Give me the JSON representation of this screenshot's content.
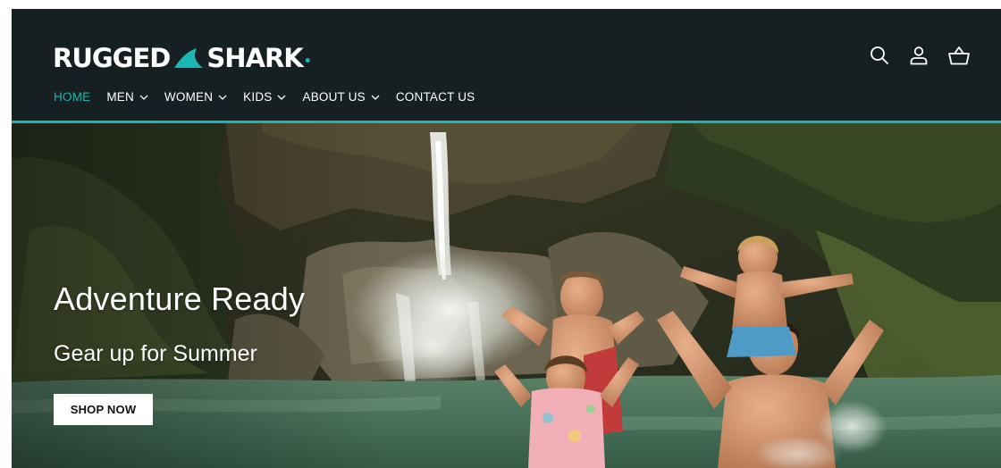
{
  "brand": {
    "name_left": "RUGGED",
    "name_right": "SHARK",
    "accent_color": "#19b6b3"
  },
  "nav": {
    "items": [
      {
        "label": "HOME",
        "active": true,
        "dropdown": false
      },
      {
        "label": "MEN",
        "active": false,
        "dropdown": true
      },
      {
        "label": "WOMEN",
        "active": false,
        "dropdown": true
      },
      {
        "label": "KIDS",
        "active": false,
        "dropdown": true
      },
      {
        "label": "ABOUT US",
        "active": false,
        "dropdown": true
      },
      {
        "label": "CONTACT US",
        "active": false,
        "dropdown": false
      }
    ]
  },
  "header_icons": [
    "search-icon",
    "account-icon",
    "cart-icon"
  ],
  "hero": {
    "title": "Adventure Ready",
    "subtitle": "Gear up for Summer",
    "button_label": "SHOP NOW"
  }
}
